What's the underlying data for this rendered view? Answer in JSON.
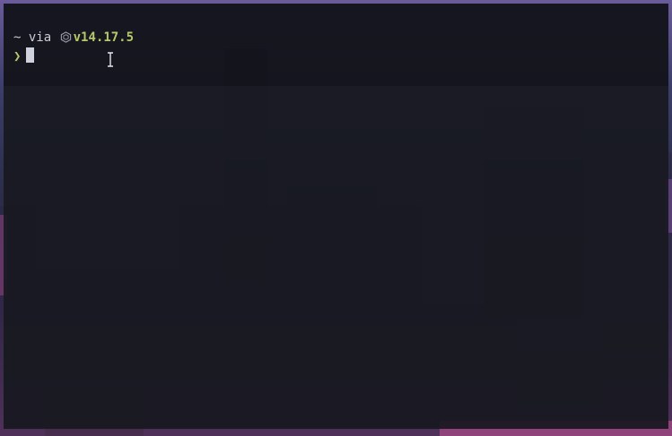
{
  "terminal": {
    "prompt_line": {
      "cwd": "~",
      "via_text": "via",
      "node_icon": "nodejs-hexagon-icon",
      "version": "v14.17.5"
    },
    "input_line": {
      "prompt_symbol": "❯",
      "input_value": ""
    }
  },
  "colors": {
    "terminal_bg": "#181920",
    "text": "#c9cbd6",
    "accent_green": "#b7c86a"
  }
}
